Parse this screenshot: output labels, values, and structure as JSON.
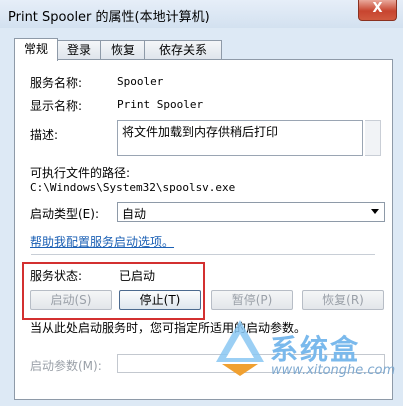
{
  "window": {
    "title": "Print Spooler 的属性(本地计算机)",
    "close_label": "X"
  },
  "tabs": [
    "常规",
    "登录",
    "恢复",
    "依存关系"
  ],
  "service": {
    "name_label": "服务名称:",
    "name_value": "Spooler",
    "display_label": "显示名称:",
    "display_value": "Print Spooler",
    "desc_label": "描述:",
    "desc_value": "将文件加载到内存供稍后打印",
    "path_label": "可执行文件的路径:",
    "path_value": "C:\\Windows\\System32\\spoolsv.exe",
    "startup_type_label": "启动类型(E):",
    "startup_type_value": "自动",
    "help_link": "帮助我配置服务启动选项。",
    "status_label": "服务状态:",
    "status_value": "已启动"
  },
  "buttons": {
    "start": "启动(S)",
    "stop": "停止(T)",
    "pause": "暂停(P)",
    "resume": "恢复(R)"
  },
  "hint_text": "当从此处启动服务时，您可指定所适用的启动参数。",
  "param_label": "启动参数(M):",
  "param_value": "",
  "watermark": {
    "name": "系统盒",
    "url": "www.xitonghe.com"
  }
}
